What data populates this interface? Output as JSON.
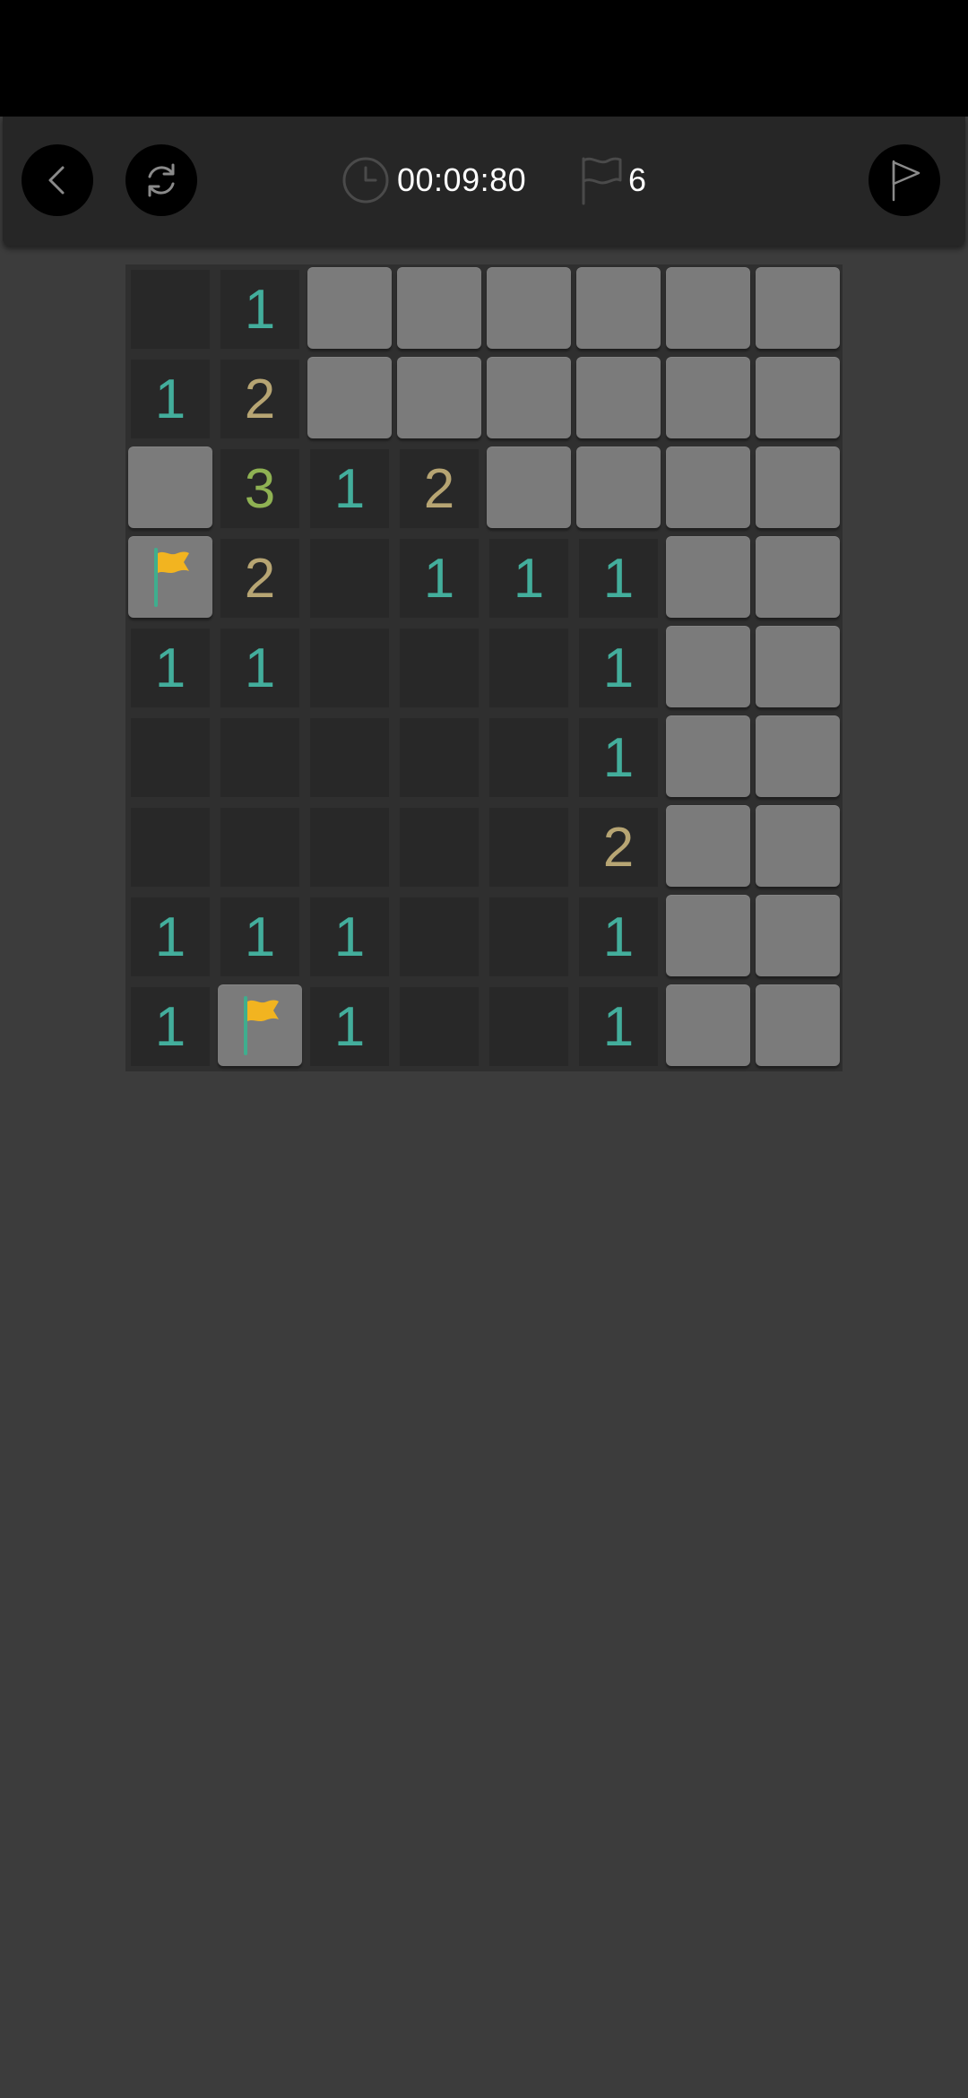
{
  "header": {
    "timer": "00:09:80",
    "flags_remaining": "6",
    "back_icon": "back-chevron-icon",
    "restart_icon": "restart-icon",
    "flag_mode_icon": "flag-mode-icon"
  },
  "colors": {
    "one": "#43ae9c",
    "two": "#b7a573",
    "three": "#8fb253",
    "hidden": "#7b7b7b",
    "revealed": "#282828",
    "flag": "#f2b420"
  },
  "board": {
    "rows": 9,
    "cols": 8,
    "cells": [
      [
        "",
        "1",
        "H",
        "H",
        "H",
        "H",
        "H",
        "H"
      ],
      [
        "1",
        "2",
        "H",
        "H",
        "H",
        "H",
        "H",
        "H"
      ],
      [
        "H",
        "3",
        "1",
        "2",
        "H",
        "H",
        "H",
        "H"
      ],
      [
        "F",
        "2",
        "",
        "1",
        "1",
        "1",
        "H",
        "H"
      ],
      [
        "1",
        "1",
        "",
        "",
        "",
        "1",
        "H",
        "H"
      ],
      [
        "",
        "",
        "",
        "",
        "",
        "1",
        "H",
        "H"
      ],
      [
        "",
        "",
        "",
        "",
        "",
        "2",
        "H",
        "H"
      ],
      [
        "1",
        "1",
        "1",
        "",
        "",
        "1",
        "H",
        "H"
      ],
      [
        "1",
        "F",
        "1",
        "",
        "",
        "1",
        "H",
        "H"
      ]
    ]
  }
}
